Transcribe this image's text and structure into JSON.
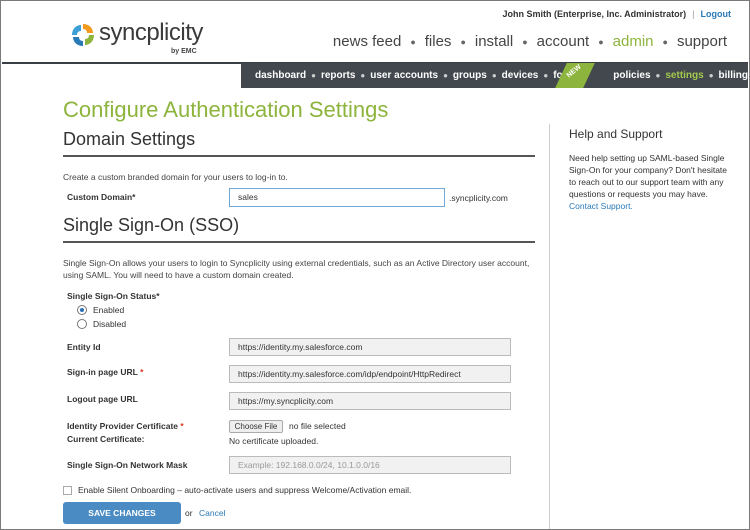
{
  "header": {
    "logo_text": "syncplicity",
    "logo_sub": "by EMC",
    "user": "John Smith (Enterprise, Inc. Administrator)",
    "logout": "Logout"
  },
  "mainnav": {
    "items": [
      "news feed",
      "files",
      "install",
      "account",
      "admin",
      "support"
    ],
    "active": "admin"
  },
  "subnav": {
    "items": [
      "dashboard",
      "reports",
      "user accounts",
      "groups",
      "devices",
      "folders",
      "policies",
      "settings",
      "billing"
    ],
    "active": "settings",
    "new_badge": "NEW"
  },
  "page": {
    "title": "Configure Authentication Settings"
  },
  "domain": {
    "title": "Domain Settings",
    "description": "Create a custom branded domain for your users to log-in to.",
    "custom_domain_label": "Custom Domain*",
    "custom_domain_value": "sales",
    "suffix": ".syncplicity.com"
  },
  "sso": {
    "title": "Single Sign-On (SSO)",
    "description": "Single Sign-On allows your users to login to Syncplicity using external credentials, such as an Active Directory user account, using SAML. You will need to have a custom domain created.",
    "status_label": "Single Sign-On Status*",
    "enabled_label": "Enabled",
    "disabled_label": "Disabled",
    "entity_id_label": "Entity Id",
    "entity_id_value": "https://identity.my.salesforce.com",
    "signin_label": "Sign-in page URL",
    "signin_value": "https://identity.my.salesforce.com/idp/endpoint/HttpRedirect",
    "logout_label": "Logout page URL",
    "logout_value": "https://my.syncplicity.com",
    "cert_label": "Identity Provider Certificate",
    "current_cert_label": "Current Certificate:",
    "choose_file": "Choose File",
    "no_file": "no file selected",
    "no_cert": "No certificate uploaded.",
    "mask_label": "Single Sign-On Network Mask",
    "mask_placeholder": "Example: 192.168.0.0/24, 10.1.0.0/16",
    "silent_label": "Enable Silent Onboarding – auto-activate users and suppress Welcome/Activation email.",
    "required_mark": "*"
  },
  "actions": {
    "save": "SAVE CHANGES",
    "or": "or",
    "cancel": "Cancel"
  },
  "sidebar": {
    "title": "Help and Support",
    "text": "Need help setting up SAML-based Single Sign-On for your company? Don't hesitate to reach out to our support team with any questions or requests you may have.",
    "link": "Contact Support."
  },
  "colors": {
    "accent_green": "#8db43c",
    "link_blue": "#2a7ab8",
    "subnav_bg": "#43484e",
    "button_blue": "#4b8bc4"
  }
}
